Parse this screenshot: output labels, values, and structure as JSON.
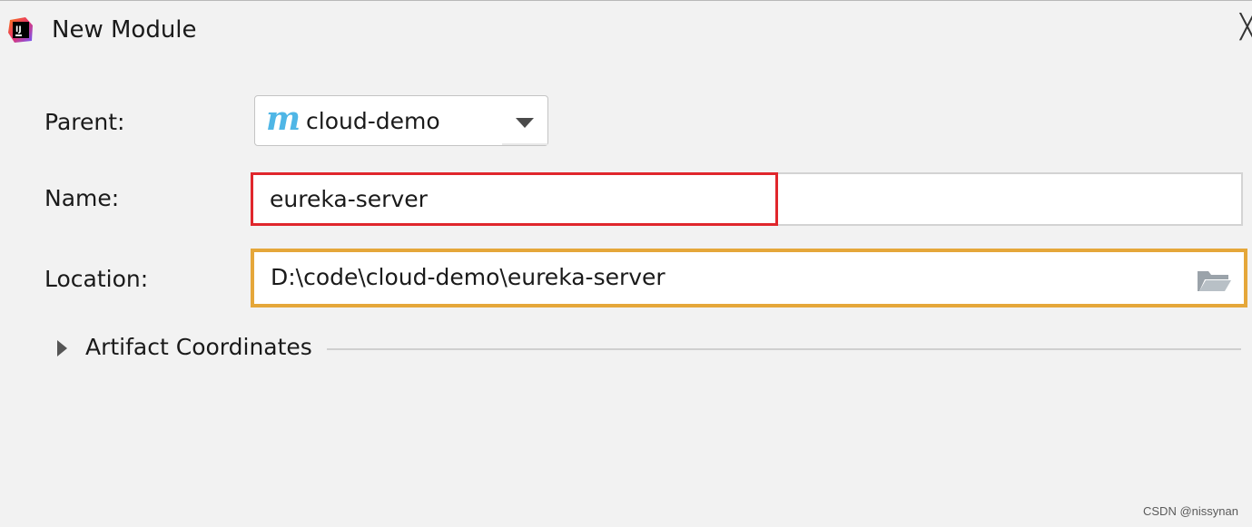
{
  "window": {
    "title": "New Module",
    "app_icon": "intellij-idea-icon",
    "close_icon": "close-icon",
    "close_glyph": "╳"
  },
  "form": {
    "parent": {
      "label": "Parent:",
      "value": "cloud-demo",
      "icon": "maven-icon",
      "icon_glyph": "m"
    },
    "name": {
      "label": "Name:",
      "value": "eureka-server",
      "highlight_color": "#e0262c"
    },
    "location": {
      "label": "Location:",
      "value": "D:\\code\\cloud-demo\\eureka-server",
      "highlight_color": "#e5a73a",
      "browse_icon": "folder-open-icon"
    }
  },
  "artifact_section": {
    "label": "Artifact Coordinates",
    "expanded": false
  },
  "watermark": "CSDN @nissynan"
}
